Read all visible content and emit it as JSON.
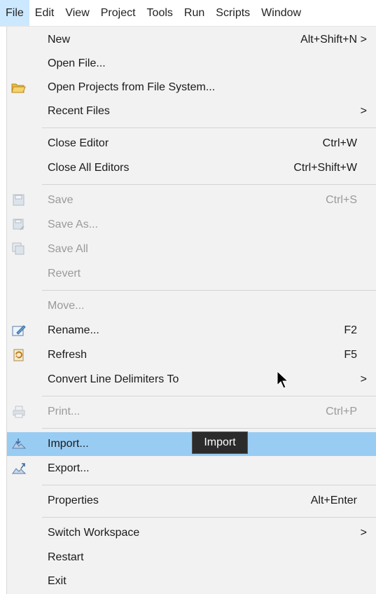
{
  "menubar": [
    "File",
    "Edit",
    "View",
    "Project",
    "Tools",
    "Run",
    "Scripts",
    "Window"
  ],
  "items": [
    {
      "label": "New",
      "shortcut": "Alt+Shift+N",
      "submenu": true
    },
    {
      "label": "Open File..."
    },
    {
      "label": "Open Projects from File System...",
      "icon": "folder-icon"
    },
    {
      "label": "Recent Files",
      "submenu": true
    },
    {
      "label": "Close Editor",
      "shortcut": "Ctrl+W"
    },
    {
      "label": "Close All Editors",
      "shortcut": "Ctrl+Shift+W"
    },
    {
      "label": "Save",
      "shortcut": "Ctrl+S",
      "disabled": true,
      "icon": "save-icon"
    },
    {
      "label": "Save As...",
      "disabled": true,
      "icon": "save-as-icon"
    },
    {
      "label": "Save All",
      "disabled": true,
      "icon": "save-all-icon"
    },
    {
      "label": "Revert",
      "disabled": true
    },
    {
      "label": "Move...",
      "disabled": true
    },
    {
      "label": "Rename...",
      "shortcut": "F2",
      "icon": "rename-icon"
    },
    {
      "label": "Refresh",
      "shortcut": "F5",
      "icon": "refresh-icon"
    },
    {
      "label": "Convert Line Delimiters To",
      "submenu": true
    },
    {
      "label": "Print...",
      "shortcut": "Ctrl+P",
      "disabled": true,
      "icon": "print-icon"
    },
    {
      "label": "Import...",
      "highlighted": true,
      "icon": "import-icon"
    },
    {
      "label": "Export...",
      "icon": "export-icon"
    },
    {
      "label": "Properties",
      "shortcut": "Alt+Enter"
    },
    {
      "label": "Switch Workspace",
      "submenu": true
    },
    {
      "label": "Restart"
    },
    {
      "label": "Exit"
    }
  ],
  "submenu_arrow": ">",
  "tooltip": "Import"
}
